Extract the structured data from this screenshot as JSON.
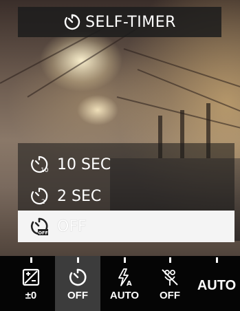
{
  "header": {
    "title": "SELF-TIMER",
    "icon": "self-timer-icon"
  },
  "menu": {
    "items": [
      {
        "label": "10 SEC",
        "icon": "timer-10-icon",
        "selected": false
      },
      {
        "label": "2 SEC",
        "icon": "timer-2-icon",
        "selected": false
      },
      {
        "label": "OFF",
        "icon": "timer-off-icon",
        "selected": true
      }
    ]
  },
  "toolbar": {
    "items": [
      {
        "caption": "±0",
        "icon": "exposure-compensation-icon",
        "active": false
      },
      {
        "caption": "OFF",
        "icon": "self-timer-icon",
        "active": true
      },
      {
        "caption": "AUTO",
        "icon": "flash-auto-icon",
        "active": false
      },
      {
        "caption": "OFF",
        "icon": "macro-off-icon",
        "active": false
      },
      {
        "caption": "AUTO",
        "icon": "",
        "active": false
      }
    ]
  },
  "colors": {
    "overlay": "#1c1c1c",
    "selected_row": "#f4f4f4",
    "active_cell": "#3c3c3c",
    "text": "#ffffff"
  }
}
